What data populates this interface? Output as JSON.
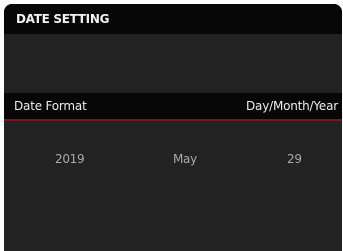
{
  "screen": {
    "title": "DATE SETTING",
    "date_format": {
      "label": "Date Format",
      "value": "Day/Month/Year"
    },
    "date": {
      "year": "2019",
      "month": "May",
      "day": "29"
    }
  },
  "colors": {
    "background": "#222222",
    "bar": "#070707",
    "accent": "#7a1422",
    "text": "#efefef",
    "muted_text": "#a9a9a9"
  }
}
